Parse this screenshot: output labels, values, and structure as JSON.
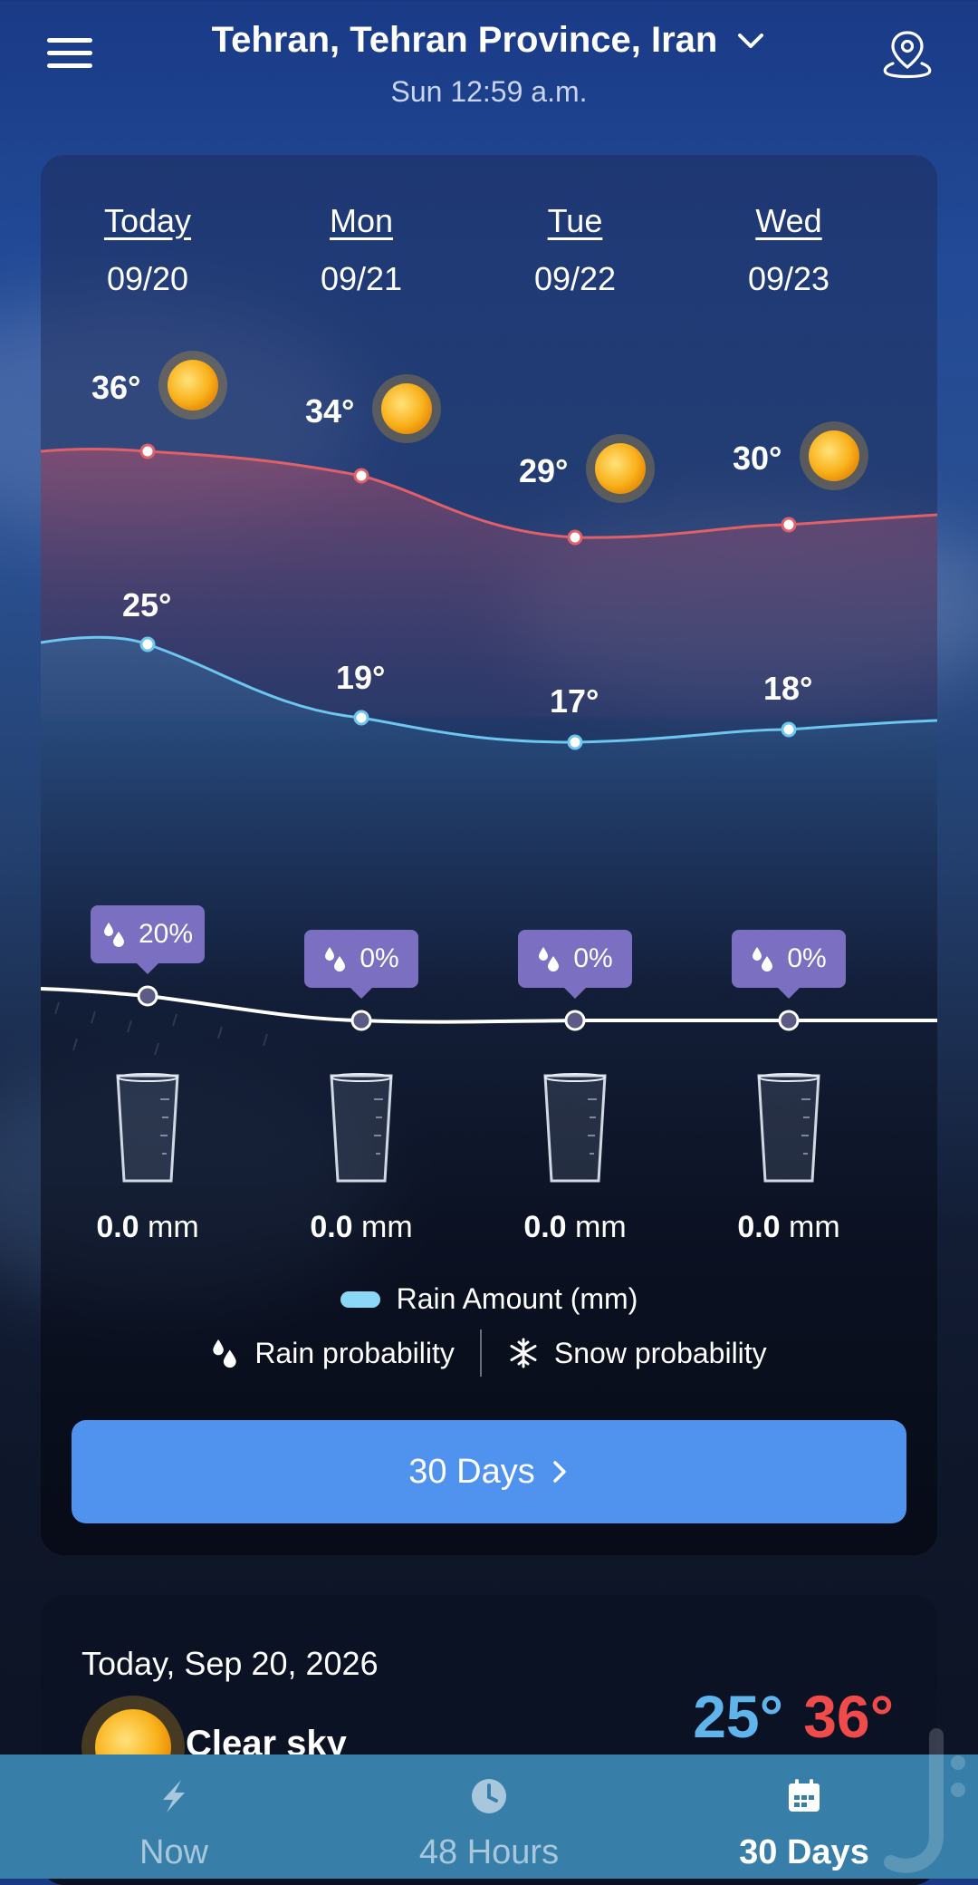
{
  "header": {
    "location": "Tehran, Tehran Province, Iran",
    "time": "Sun 12:59 a.m."
  },
  "forecast": {
    "days": [
      {
        "name": "Today",
        "date": "09/20",
        "high": "36°",
        "low": "25°",
        "rain_prob": "20%",
        "rain_value": "0.0",
        "rain_unit": "mm"
      },
      {
        "name": "Mon",
        "date": "09/21",
        "high": "34°",
        "low": "19°",
        "rain_prob": "0%",
        "rain_value": "0.0",
        "rain_unit": "mm"
      },
      {
        "name": "Tue",
        "date": "09/22",
        "high": "29°",
        "low": "17°",
        "rain_prob": "0%",
        "rain_value": "0.0",
        "rain_unit": "mm"
      },
      {
        "name": "Wed",
        "date": "09/23",
        "high": "30°",
        "low": "18°",
        "rain_prob": "0%",
        "rain_value": "0.0",
        "rain_unit": "mm"
      }
    ],
    "legend": {
      "rain_amount": "Rain Amount (mm)",
      "rain_probability": "Rain probability",
      "snow_probability": "Snow probability"
    },
    "button_label": "30 Days"
  },
  "today": {
    "date": "Today, Sep 20, 2026",
    "summary": "Clear sky",
    "low": "25°",
    "high": "36°"
  },
  "nav": {
    "items": [
      {
        "label": "Now",
        "icon": "bolt-icon"
      },
      {
        "label": "48 Hours",
        "icon": "clock-icon"
      },
      {
        "label": "30 Days",
        "icon": "calendar-icon"
      }
    ],
    "active": "30 Days"
  },
  "colors": {
    "high_line": "#e0606a",
    "low_line": "#6cc6ee",
    "pill": "#7a6fc0",
    "button": "#4f93ef",
    "nav_bg": "#377fa8",
    "low_temp": "#5fb4ec",
    "high_temp": "#f04b4b"
  }
}
